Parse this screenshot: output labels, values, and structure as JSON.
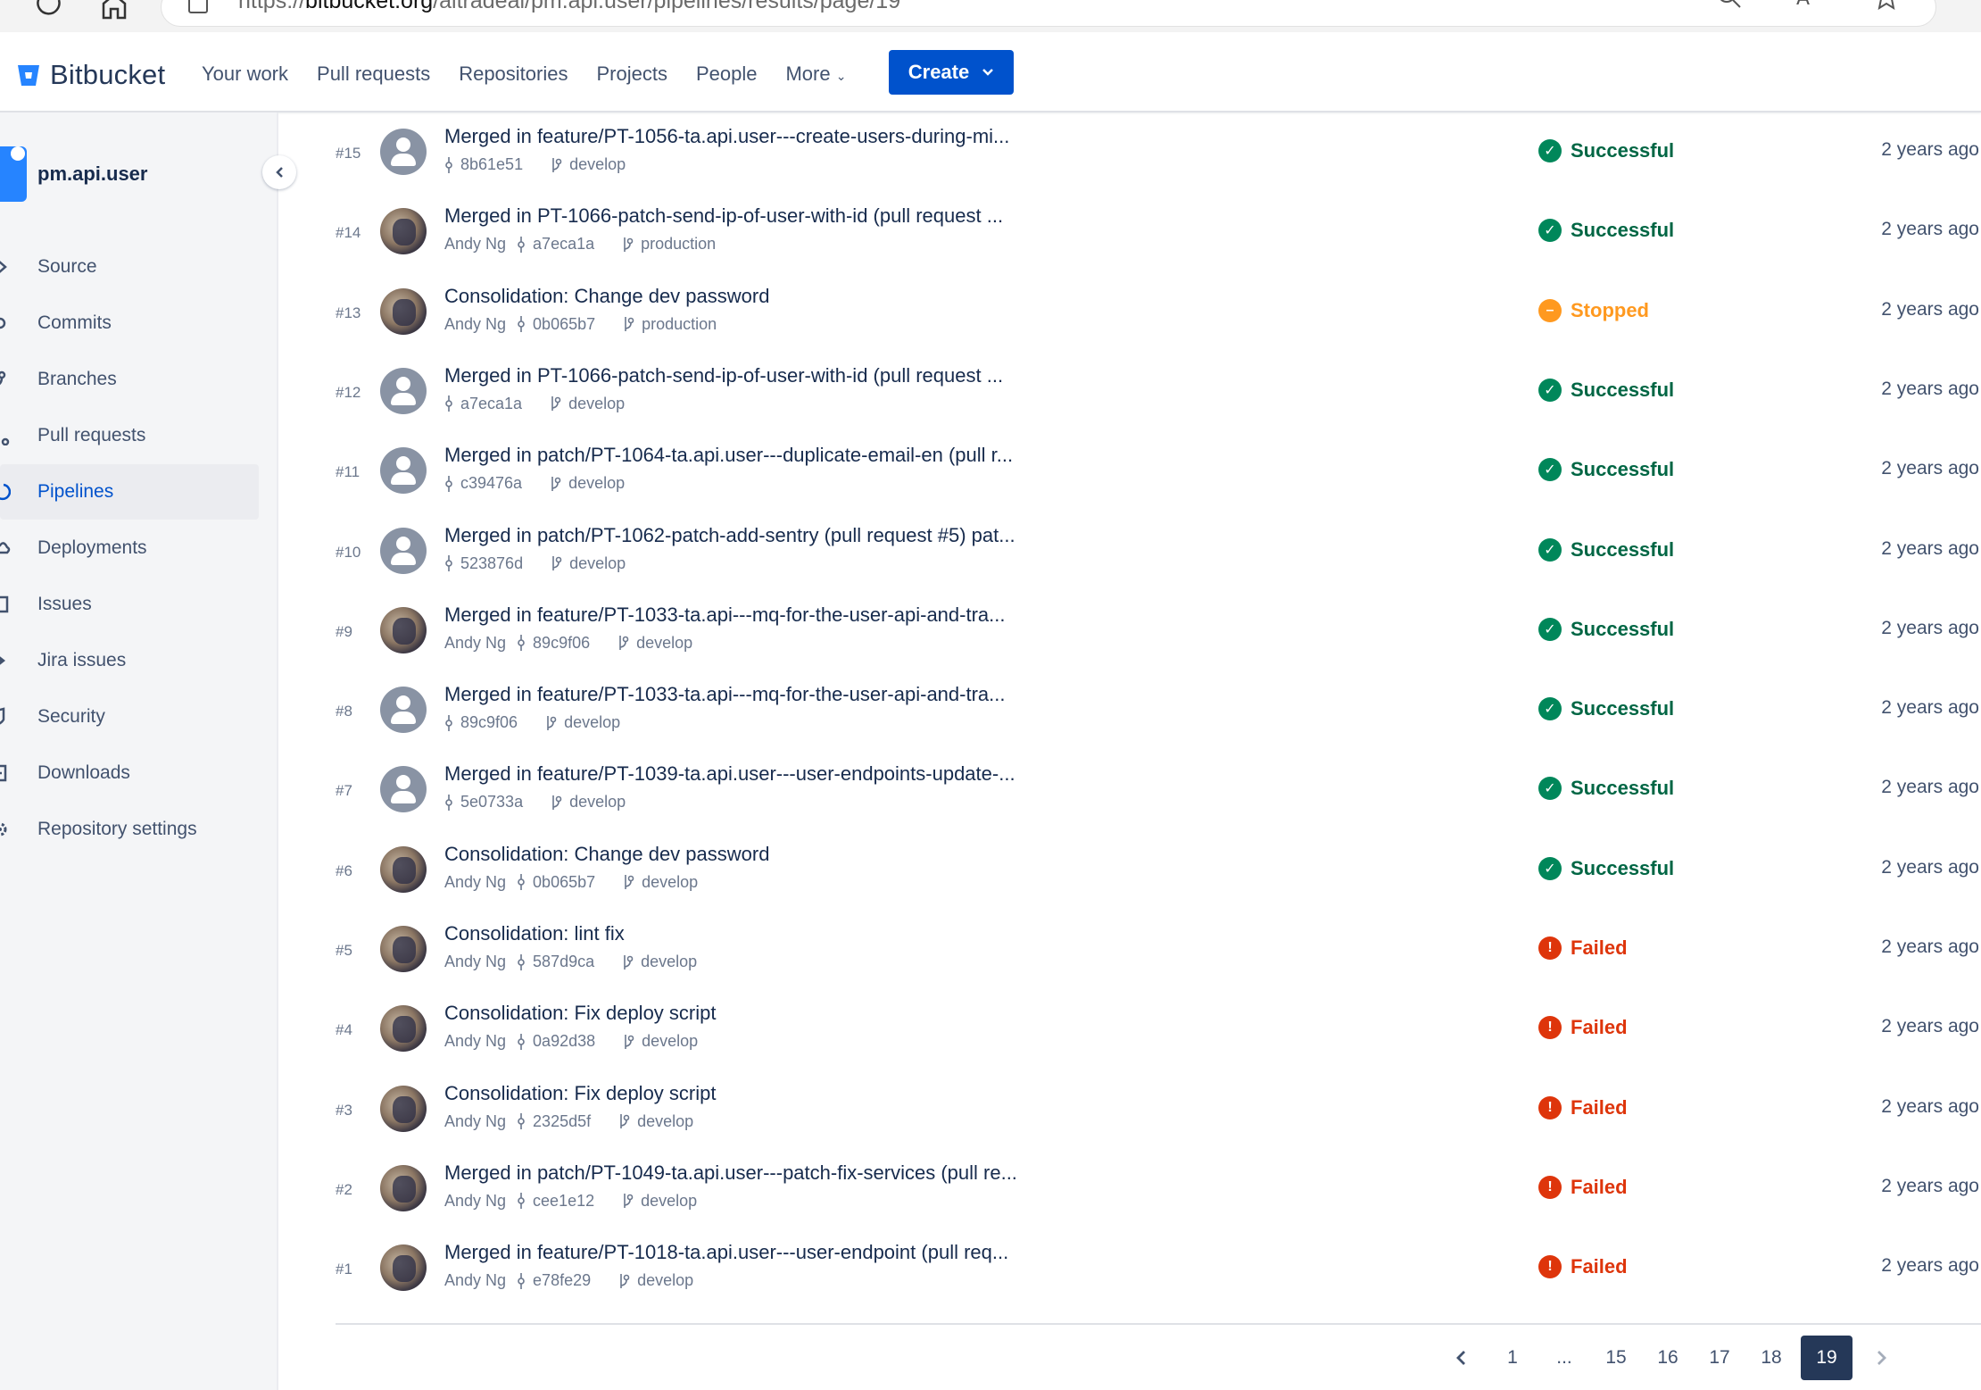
{
  "browser": {
    "url_prefix": "https://",
    "url_domain": "bitbucket.org",
    "url_path": "/aitradeai/pm.api.user/pipelines/results/page/19"
  },
  "header": {
    "brand": "Bitbucket",
    "nav": [
      "Your work",
      "Pull requests",
      "Repositories",
      "Projects",
      "People",
      "More"
    ],
    "create_label": "Create"
  },
  "sidebar": {
    "repo_name": "pm.api.user",
    "items": [
      {
        "label": "Source",
        "icon": "chevron-right-icon"
      },
      {
        "label": "Commits",
        "icon": "commit-icon"
      },
      {
        "label": "Branches",
        "icon": "branch-icon"
      },
      {
        "label": "Pull requests",
        "icon": "pull-request-icon"
      },
      {
        "label": "Pipelines",
        "icon": "pipelines-icon"
      },
      {
        "label": "Deployments",
        "icon": "cloud-icon"
      },
      {
        "label": "Issues",
        "icon": "issues-icon"
      },
      {
        "label": "Jira issues",
        "icon": "jira-icon"
      },
      {
        "label": "Security",
        "icon": "shield-icon"
      },
      {
        "label": "Downloads",
        "icon": "download-icon"
      },
      {
        "label": "Repository settings",
        "icon": "gear-icon"
      }
    ],
    "active": "Pipelines"
  },
  "pipelines": [
    {
      "num": "#15",
      "title": "Merged in feature/PT-1056-ta.api.user---create-users-during-mi...",
      "author": "",
      "commit": "8b61e51",
      "branch": "develop",
      "status": "Successful",
      "kind": "ok",
      "avatar": "generic",
      "when": "2 years ago"
    },
    {
      "num": "#14",
      "title": "Merged in PT-1066-patch-send-ip-of-user-with-id (pull request ...",
      "author": "Andy Ng",
      "commit": "a7eca1a",
      "branch": "production",
      "status": "Successful",
      "kind": "ok",
      "avatar": "photo",
      "when": "2 years ago"
    },
    {
      "num": "#13",
      "title": "Consolidation: Change dev password",
      "author": "Andy Ng",
      "commit": "0b065b7",
      "branch": "production",
      "status": "Stopped",
      "kind": "stop",
      "avatar": "photo",
      "when": "2 years ago"
    },
    {
      "num": "#12",
      "title": "Merged in PT-1066-patch-send-ip-of-user-with-id (pull request ...",
      "author": "",
      "commit": "a7eca1a",
      "branch": "develop",
      "status": "Successful",
      "kind": "ok",
      "avatar": "generic",
      "when": "2 years ago"
    },
    {
      "num": "#11",
      "title": "Merged in patch/PT-1064-ta.api.user---duplicate-email-en (pull r...",
      "author": "",
      "commit": "c39476a",
      "branch": "develop",
      "status": "Successful",
      "kind": "ok",
      "avatar": "generic",
      "when": "2 years ago"
    },
    {
      "num": "#10",
      "title": "Merged in patch/PT-1062-patch-add-sentry (pull request #5) pat...",
      "author": "",
      "commit": "523876d",
      "branch": "develop",
      "status": "Successful",
      "kind": "ok",
      "avatar": "generic",
      "when": "2 years ago"
    },
    {
      "num": "#9",
      "title": "Merged in feature/PT-1033-ta.api---mq-for-the-user-api-and-tra...",
      "author": "Andy Ng",
      "commit": "89c9f06",
      "branch": "develop",
      "status": "Successful",
      "kind": "ok",
      "avatar": "photo",
      "when": "2 years ago"
    },
    {
      "num": "#8",
      "title": "Merged in feature/PT-1033-ta.api---mq-for-the-user-api-and-tra...",
      "author": "",
      "commit": "89c9f06",
      "branch": "develop",
      "status": "Successful",
      "kind": "ok",
      "avatar": "generic",
      "when": "2 years ago"
    },
    {
      "num": "#7",
      "title": "Merged in feature/PT-1039-ta.api.user---user-endpoints-update-...",
      "author": "",
      "commit": "5e0733a",
      "branch": "develop",
      "status": "Successful",
      "kind": "ok",
      "avatar": "generic",
      "when": "2 years ago"
    },
    {
      "num": "#6",
      "title": "Consolidation: Change dev password",
      "author": "Andy Ng",
      "commit": "0b065b7",
      "branch": "develop",
      "status": "Successful",
      "kind": "ok",
      "avatar": "photo",
      "when": "2 years ago"
    },
    {
      "num": "#5",
      "title": "Consolidation: lint fix",
      "author": "Andy Ng",
      "commit": "587d9ca",
      "branch": "develop",
      "status": "Failed",
      "kind": "fail",
      "avatar": "photo",
      "when": "2 years ago"
    },
    {
      "num": "#4",
      "title": "Consolidation: Fix deploy script",
      "author": "Andy Ng",
      "commit": "0a92d38",
      "branch": "develop",
      "status": "Failed",
      "kind": "fail",
      "avatar": "photo",
      "when": "2 years ago"
    },
    {
      "num": "#3",
      "title": "Consolidation: Fix deploy script",
      "author": "Andy Ng",
      "commit": "2325d5f",
      "branch": "develop",
      "status": "Failed",
      "kind": "fail",
      "avatar": "photo",
      "when": "2 years ago"
    },
    {
      "num": "#2",
      "title": "Merged in patch/PT-1049-ta.api.user---patch-fix-services (pull re...",
      "author": "Andy Ng",
      "commit": "cee1e12",
      "branch": "develop",
      "status": "Failed",
      "kind": "fail",
      "avatar": "photo",
      "when": "2 years ago"
    },
    {
      "num": "#1",
      "title": "Merged in feature/PT-1018-ta.api.user---user-endpoint (pull req...",
      "author": "Andy Ng",
      "commit": "e78fe29",
      "branch": "develop",
      "status": "Failed",
      "kind": "fail",
      "avatar": "photo",
      "when": "2 years ago"
    }
  ],
  "pagination": {
    "pages": [
      "1",
      "...",
      "15",
      "16",
      "17",
      "18",
      "19"
    ],
    "current": "19"
  },
  "colors": {
    "brand_blue": "#0052cc",
    "success": "#00875a",
    "stopped": "#ff991f",
    "failed": "#de350b"
  }
}
